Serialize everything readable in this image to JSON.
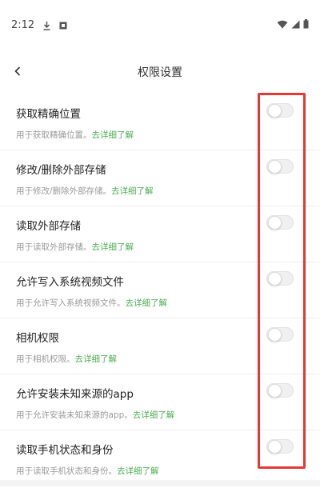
{
  "status_bar": {
    "time": "2:12",
    "icons": [
      "download-icon",
      "record-icon",
      "wifi-icon",
      "signal-icon",
      "battery-icon"
    ]
  },
  "header": {
    "title": "权限设置",
    "back_icon": "chevron-left-icon"
  },
  "permissions": [
    {
      "title": "获取精确位置",
      "desc": "用于获取精确位置。",
      "link": "去详细了解",
      "enabled": false
    },
    {
      "title": "修改/删除外部存储",
      "desc": "用于修改/删除外部存储。",
      "link": "去详细了解",
      "enabled": false
    },
    {
      "title": "读取外部存储",
      "desc": "用于读取外部存储。",
      "link": "去详细了解",
      "enabled": false
    },
    {
      "title": "允许写入系统视频文件",
      "desc": "用于允许写入系统视频文件。",
      "link": "去详细了解",
      "enabled": false
    },
    {
      "title": "相机权限",
      "desc": "用于相机权限。",
      "link": "去详细了解",
      "enabled": false
    },
    {
      "title": "允许安装未知来源的app",
      "desc": "用于允许安装未知来源的app。",
      "link": "去详细了解",
      "enabled": false
    },
    {
      "title": "读取手机状态和身份",
      "desc": "用于读取手机状态和身份。",
      "link": "去详细了解",
      "enabled": false
    }
  ],
  "colors": {
    "link": "#4caf50",
    "highlight_border": "#e53935",
    "toggle_off": "#f0f0f0"
  }
}
